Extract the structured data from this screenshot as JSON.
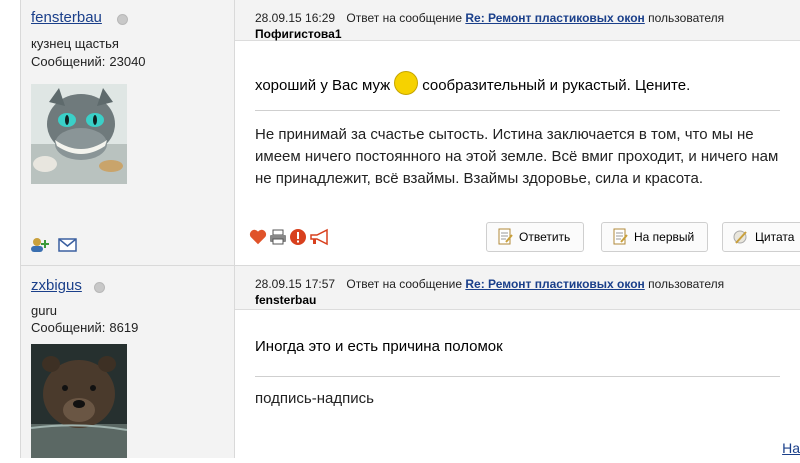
{
  "posts": [
    {
      "author": {
        "name": "fensterbau",
        "title": "кузнец щастья",
        "posts_label": "Сообщений:",
        "posts_count": "23040"
      },
      "meta": {
        "datetime": "28.09.15 16:29",
        "reply_prefix": "Ответ на сообщение",
        "thread_link": "Re: Ремонт пластиковых окон",
        "suffix": "пользователя",
        "recipient": "Пофигистова1"
      },
      "body": {
        "line1_a": "хороший у Вас муж",
        "line1_b": "сообразительный и рукастый. Цените.",
        "signature": "Не принимай за счастье сытость. Истина заключается в том, что мы не имеем ничего постоянного на этой земле. Всё вмиг проходит, и ничего нам не принадлежит, всё взаймы. Взаймы здоровье, сила и красота."
      },
      "buttons": {
        "reply": "Ответить",
        "first": "На первый",
        "quote": "Цитата"
      }
    },
    {
      "author": {
        "name": "zxbigus",
        "title": "guru",
        "posts_label": "Сообщений:",
        "posts_count": "8619"
      },
      "meta": {
        "datetime": "28.09.15 17:57",
        "reply_prefix": "Ответ на сообщение",
        "thread_link": "Re: Ремонт пластиковых окон",
        "suffix": "пользователя",
        "recipient": "fensterbau"
      },
      "body": {
        "text": "Иногда это и есть причина поломок",
        "signature": "подпись-надпись"
      }
    }
  ],
  "bottom_link": "На",
  "icons": [
    "add-friend-icon",
    "envelope-icon",
    "heart-icon",
    "printer-icon",
    "alert-icon",
    "megaphone-icon",
    "document-icon",
    "quote-icon",
    "smiley-grin-icon"
  ]
}
